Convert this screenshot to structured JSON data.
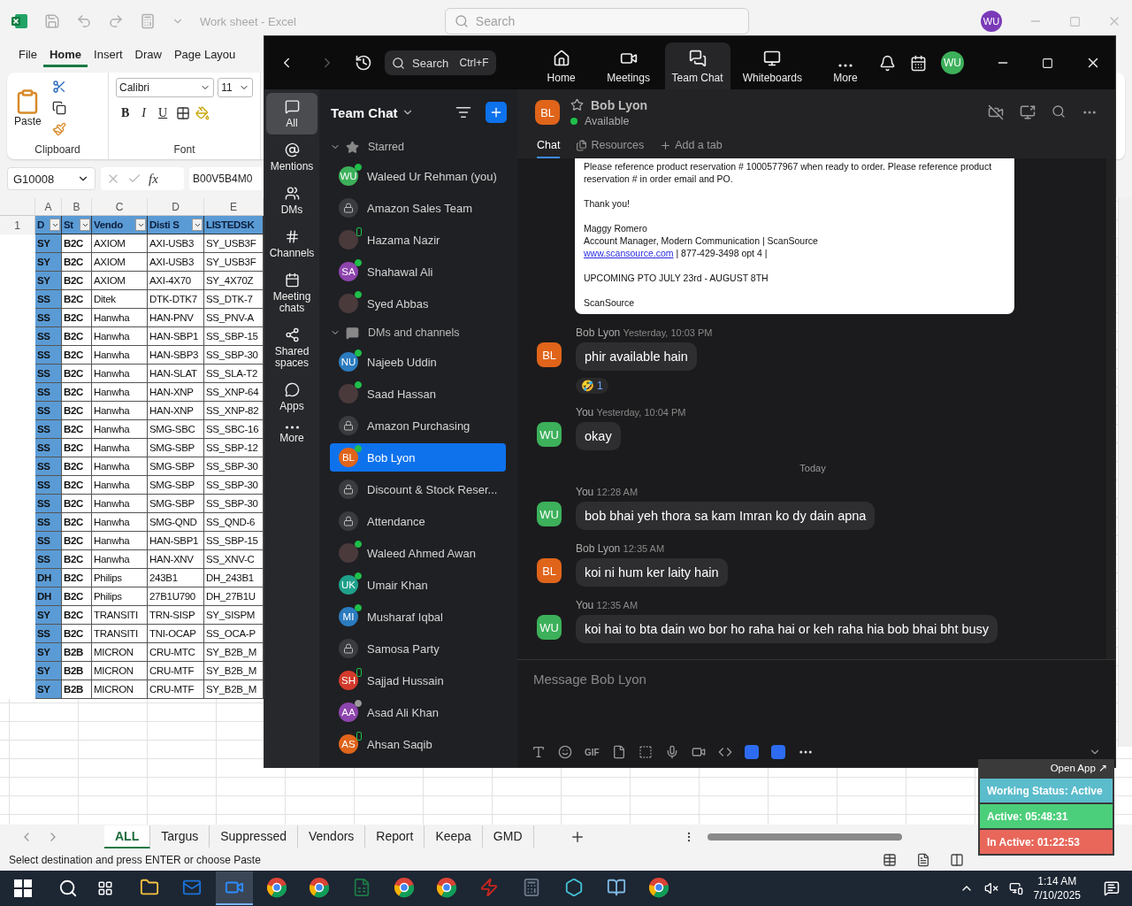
{
  "excel": {
    "title": "Work sheet  -  Excel",
    "search_placeholder": "Search",
    "user_initials": "WU",
    "ribbon_tabs": [
      {
        "label": "File",
        "selected": false
      },
      {
        "label": "Home",
        "selected": true
      },
      {
        "label": "Insert",
        "selected": false
      },
      {
        "label": "Draw",
        "selected": false
      },
      {
        "label": "Page Layou",
        "selected": false
      }
    ],
    "ribbon": {
      "paste": "Paste",
      "clipboard_group": "Clipboard",
      "font_group": "Font",
      "font_name": "Calibri",
      "font_size": "11",
      "format_buttons": [
        "B",
        "I",
        "U"
      ]
    },
    "formula_bar": {
      "name_box": "G10008",
      "fx": "fx",
      "formula": "B00V5B4M0"
    },
    "columns": [
      "A",
      "B",
      "C",
      "D",
      "E"
    ],
    "header_row_number": "1",
    "header": [
      "D",
      "St",
      "Vendo",
      "Disti S",
      "LISTEDSK"
    ],
    "rows": [
      [
        "SY",
        "B2C",
        "AXIOM",
        "AXI-USB3",
        "SY_USB3F"
      ],
      [
        "SY",
        "B2C",
        "AXIOM",
        "AXI-USB3",
        "SY_USB3F"
      ],
      [
        "SY",
        "B2C",
        "AXIOM",
        "AXI-4X70",
        "SY_4X70Z"
      ],
      [
        "SS",
        "B2C",
        "Ditek",
        "DTK-DTK7",
        "SS_DTK-7"
      ],
      [
        "SS",
        "B2C",
        "Hanwha",
        "HAN-PNV",
        "SS_PNV-A"
      ],
      [
        "SS",
        "B2C",
        "Hanwha",
        "HAN-SBP1",
        "SS_SBP-15"
      ],
      [
        "SS",
        "B2C",
        "Hanwha",
        "HAN-SBP3",
        "SS_SBP-30"
      ],
      [
        "SS",
        "B2C",
        "Hanwha",
        "HAN-SLAT",
        "SS_SLA-T2"
      ],
      [
        "SS",
        "B2C",
        "Hanwha",
        "HAN-XNP",
        "SS_XNP-64"
      ],
      [
        "SS",
        "B2C",
        "Hanwha",
        "HAN-XNP",
        "SS_XNP-82"
      ],
      [
        "SS",
        "B2C",
        "Hanwha",
        "SMG-SBC",
        "SS_SBC-16"
      ],
      [
        "SS",
        "B2C",
        "Hanwha",
        "SMG-SBP",
        "SS_SBP-12"
      ],
      [
        "SS",
        "B2C",
        "Hanwha",
        "SMG-SBP",
        "SS_SBP-30"
      ],
      [
        "SS",
        "B2C",
        "Hanwha",
        "SMG-SBP",
        "SS_SBP-30"
      ],
      [
        "SS",
        "B2C",
        "Hanwha",
        "SMG-SBP",
        "SS_SBP-30"
      ],
      [
        "SS",
        "B2C",
        "Hanwha",
        "SMG-QND",
        "SS_QND-6"
      ],
      [
        "SS",
        "B2C",
        "Hanwha",
        "HAN-SBP1",
        "SS_SBP-15"
      ],
      [
        "SS",
        "B2C",
        "Hanwha",
        "HAN-XNV",
        "SS_XNV-C"
      ],
      [
        "DH",
        "B2C",
        "Philips",
        "243B1",
        "DH_243B1"
      ],
      [
        "DH",
        "B2C",
        "Philips",
        "27B1U790",
        "DH_27B1U"
      ],
      [
        "SY",
        "B2C",
        "TRANSITI",
        "TRN-SISP",
        "SY_SISPM"
      ],
      [
        "SS",
        "B2C",
        "TRANSITI",
        "TNI-OCAP",
        "SS_OCA-P"
      ],
      [
        "SY",
        "B2B",
        "MICRON",
        "CRU-MTC",
        "SY_B2B_M"
      ],
      [
        "SY",
        "B2B",
        "MICRON",
        "CRU-MTF",
        "SY_B2B_M"
      ],
      [
        "SY",
        "B2B",
        "MICRON",
        "CRU-MTF",
        "SY_B2B_M"
      ]
    ],
    "sheet_tabs": [
      {
        "label": "ALL",
        "selected": true
      },
      {
        "label": "Targus",
        "selected": false
      },
      {
        "label": "Suppressed",
        "selected": false
      },
      {
        "label": "Vendors",
        "selected": false
      },
      {
        "label": "Report",
        "selected": false
      },
      {
        "label": "Keepa",
        "selected": false
      },
      {
        "label": "GMD",
        "selected": false
      }
    ],
    "status_text": "Select destination and press ENTER or choose Paste"
  },
  "zoom": {
    "search": "Search",
    "search_shortcut": "Ctrl+F",
    "user_initials": "WU",
    "nav_tabs": [
      {
        "label": "Home",
        "selected": false
      },
      {
        "label": "Meetings",
        "selected": false
      },
      {
        "label": "Team Chat",
        "selected": true
      },
      {
        "label": "Whiteboards",
        "selected": false
      },
      {
        "label": "More",
        "selected": false
      }
    ],
    "rail": [
      {
        "label": "All",
        "selected": true
      },
      {
        "label": "Mentions",
        "selected": false
      },
      {
        "label": "DMs",
        "selected": false
      },
      {
        "label": "Channels",
        "selected": false
      },
      {
        "label": "Meeting chats",
        "selected": false
      },
      {
        "label": "Shared spaces",
        "selected": false
      },
      {
        "label": "Apps",
        "selected": false
      },
      {
        "label": "More",
        "selected": false
      }
    ],
    "list_title": "Team Chat",
    "sections": [
      {
        "title": "Starred",
        "expanded": true,
        "items": [
          {
            "name": "Waleed Ur Rehman (you)",
            "kind": "initials",
            "initials": "WU",
            "color": "#3cb05a",
            "online": true,
            "mobile": false,
            "away": false,
            "selected": false
          },
          {
            "name": "Amazon Sales Team",
            "kind": "lock",
            "online": false,
            "mobile": false,
            "away": false,
            "selected": false
          },
          {
            "name": "Hazama Nazir",
            "kind": "photo",
            "online": false,
            "mobile": true,
            "away": false,
            "selected": false
          },
          {
            "name": "Shahawal Ali",
            "kind": "initials",
            "initials": "SA",
            "color": "#8e44ad",
            "online": true,
            "mobile": false,
            "away": false,
            "selected": false
          },
          {
            "name": "Syed Abbas",
            "kind": "photo",
            "online": true,
            "mobile": false,
            "away": false,
            "selected": false
          }
        ]
      },
      {
        "title": "DMs and channels",
        "expanded": true,
        "items": [
          {
            "name": "Najeeb Uddin",
            "kind": "initials",
            "initials": "NU",
            "color": "#2b7bbf",
            "online": true,
            "mobile": false,
            "away": false,
            "selected": false
          },
          {
            "name": "Saad Hassan",
            "kind": "photo",
            "online": true,
            "mobile": false,
            "away": false,
            "selected": false
          },
          {
            "name": "Amazon Purchasing",
            "kind": "lock",
            "online": false,
            "mobile": false,
            "away": false,
            "selected": false
          },
          {
            "name": "Bob Lyon",
            "kind": "initials",
            "initials": "BL",
            "color": "#e0641a",
            "online": true,
            "mobile": false,
            "away": false,
            "selected": true
          },
          {
            "name": "Discount & Stock Reser...",
            "kind": "lock",
            "online": false,
            "mobile": false,
            "away": false,
            "selected": false
          },
          {
            "name": "Attendance",
            "kind": "lock",
            "online": false,
            "mobile": false,
            "away": false,
            "selected": false
          },
          {
            "name": "Waleed Ahmed Awan",
            "kind": "photo",
            "online": true,
            "mobile": false,
            "away": false,
            "selected": false
          },
          {
            "name": "Umair Khan",
            "kind": "initials",
            "initials": "UK",
            "color": "#1fa08a",
            "online": true,
            "mobile": false,
            "away": false,
            "selected": false
          },
          {
            "name": "Musharaf Iqbal",
            "kind": "initials",
            "initials": "MI",
            "color": "#2b7bbf",
            "online": true,
            "mobile": false,
            "away": false,
            "selected": false
          },
          {
            "name": "Samosa Party",
            "kind": "lock",
            "online": false,
            "mobile": false,
            "away": false,
            "selected": false
          },
          {
            "name": "Sajjad Hussain",
            "kind": "initials",
            "initials": "SH",
            "color": "#d33a2c",
            "online": false,
            "mobile": true,
            "away": false,
            "selected": false
          },
          {
            "name": "Asad Ali Khan",
            "kind": "initials",
            "initials": "AA",
            "color": "#8e44ad",
            "online": false,
            "mobile": false,
            "away": true,
            "selected": false
          },
          {
            "name": "Ahsan Saqib",
            "kind": "initials",
            "initials": "AS",
            "color": "#e0641a",
            "online": false,
            "mobile": true,
            "away": false,
            "selected": false
          }
        ]
      }
    ],
    "chat": {
      "initials": "BL",
      "color": "#e0641a",
      "name": "Bob Lyon",
      "status": "Available",
      "tabs": [
        {
          "label": "Chat",
          "selected": true
        },
        {
          "label": "Resources",
          "selected": false
        },
        {
          "label": "Add a tab",
          "selected": false
        }
      ],
      "email_lines": [
        {
          "kind": "text",
          "text": "Please reference product reservation #  1000577967 when ready to order. Please reference product reservation # in order email and PO."
        },
        {
          "kind": "text",
          "text": "Thank you!"
        },
        {
          "kind": "text",
          "text": "Maggy Romero"
        },
        {
          "kind": "text",
          "text": "Account Manager, Modern Communication | ScanSource"
        },
        {
          "kind": "link",
          "link": "www.scansource.com",
          "text": " | 877-429-3498 opt 4 |"
        },
        {
          "kind": "text",
          "text": "UPCOMING PTO JULY 23rd - AUGUST 8TH"
        },
        {
          "kind": "text",
          "text": "ScanSource"
        }
      ],
      "messages": [
        {
          "kind": "message",
          "sender": "Bob Lyon",
          "time": "Yesterday, 10:03 PM",
          "initials": "BL",
          "color": "#e0641a",
          "text": "phir available hain",
          "reaction": "🤣",
          "reaction_count": "1"
        },
        {
          "kind": "message",
          "sender": "You",
          "time": "Yesterday, 10:04 PM",
          "initials": "WU",
          "color": "#3cb05a",
          "text": "okay"
        },
        {
          "kind": "divider",
          "text": "Today"
        },
        {
          "kind": "message",
          "sender": "You",
          "time": "12:28 AM",
          "initials": "WU",
          "color": "#3cb05a",
          "text": "bob bhai yeh thora sa kam Imran ko dy dain apna"
        },
        {
          "kind": "message",
          "sender": "Bob Lyon",
          "time": "12:35 AM",
          "initials": "BL",
          "color": "#e0641a",
          "text": "koi ni hum ker laity hain"
        },
        {
          "kind": "message",
          "sender": "You",
          "time": "12:35 AM",
          "initials": "WU",
          "color": "#3cb05a",
          "text": "koi hai to bta dain wo bor ho raha hai or keh raha hia bob bhai bht busy"
        }
      ],
      "compose_placeholder": "Message Bob Lyon",
      "gif": "GIF"
    }
  },
  "tracker": {
    "open_app": "Open App ↗",
    "rows": [
      {
        "text": "Working Status: Active",
        "color": "#5bbccc"
      },
      {
        "text": "Active: 05:48:31",
        "color": "#4ccf7a"
      },
      {
        "text": "In Active: 01:22:53",
        "color": "#e8675a"
      }
    ]
  },
  "taskbar": {
    "apps": [
      {
        "selected": false
      },
      {
        "selected": false
      },
      {
        "selected": true
      },
      {
        "selected": false
      },
      {
        "selected": false
      },
      {
        "selected": false
      },
      {
        "selected": false
      },
      {
        "selected": false
      },
      {
        "selected": false
      },
      {
        "selected": false
      },
      {
        "selected": false
      },
      {
        "selected": false
      },
      {
        "selected": false
      }
    ],
    "time": "1:14 AM",
    "date": "7/10/2025"
  }
}
